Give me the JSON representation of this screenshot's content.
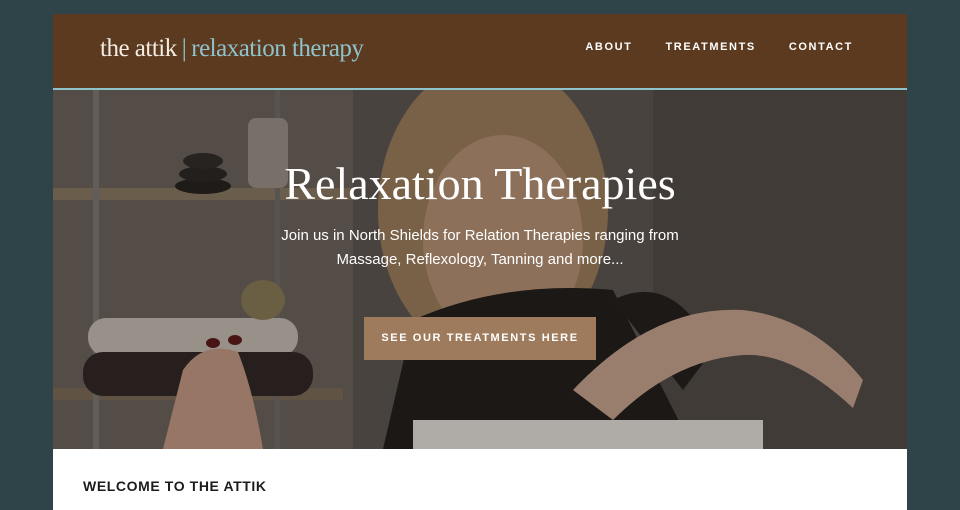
{
  "logo": {
    "brand": "the attik",
    "separator": "|",
    "subtitle": "relaxation therapy"
  },
  "nav": {
    "items": [
      {
        "label": "ABOUT"
      },
      {
        "label": "TREATMENTS"
      },
      {
        "label": "CONTACT"
      }
    ]
  },
  "hero": {
    "title": "Relaxation Therapies",
    "text": "Join us in North Shields for Relation Therapies ranging from Massage, Reflexology, Tanning and more...",
    "button_label": "SEE OUR TREATMENTS HERE"
  },
  "welcome": {
    "heading": "WELCOME TO THE ATTIK"
  },
  "colors": {
    "background": "#2f4448",
    "header": "#5b3a20",
    "accent": "#8fc3cc",
    "button": "#9f7b5d"
  }
}
